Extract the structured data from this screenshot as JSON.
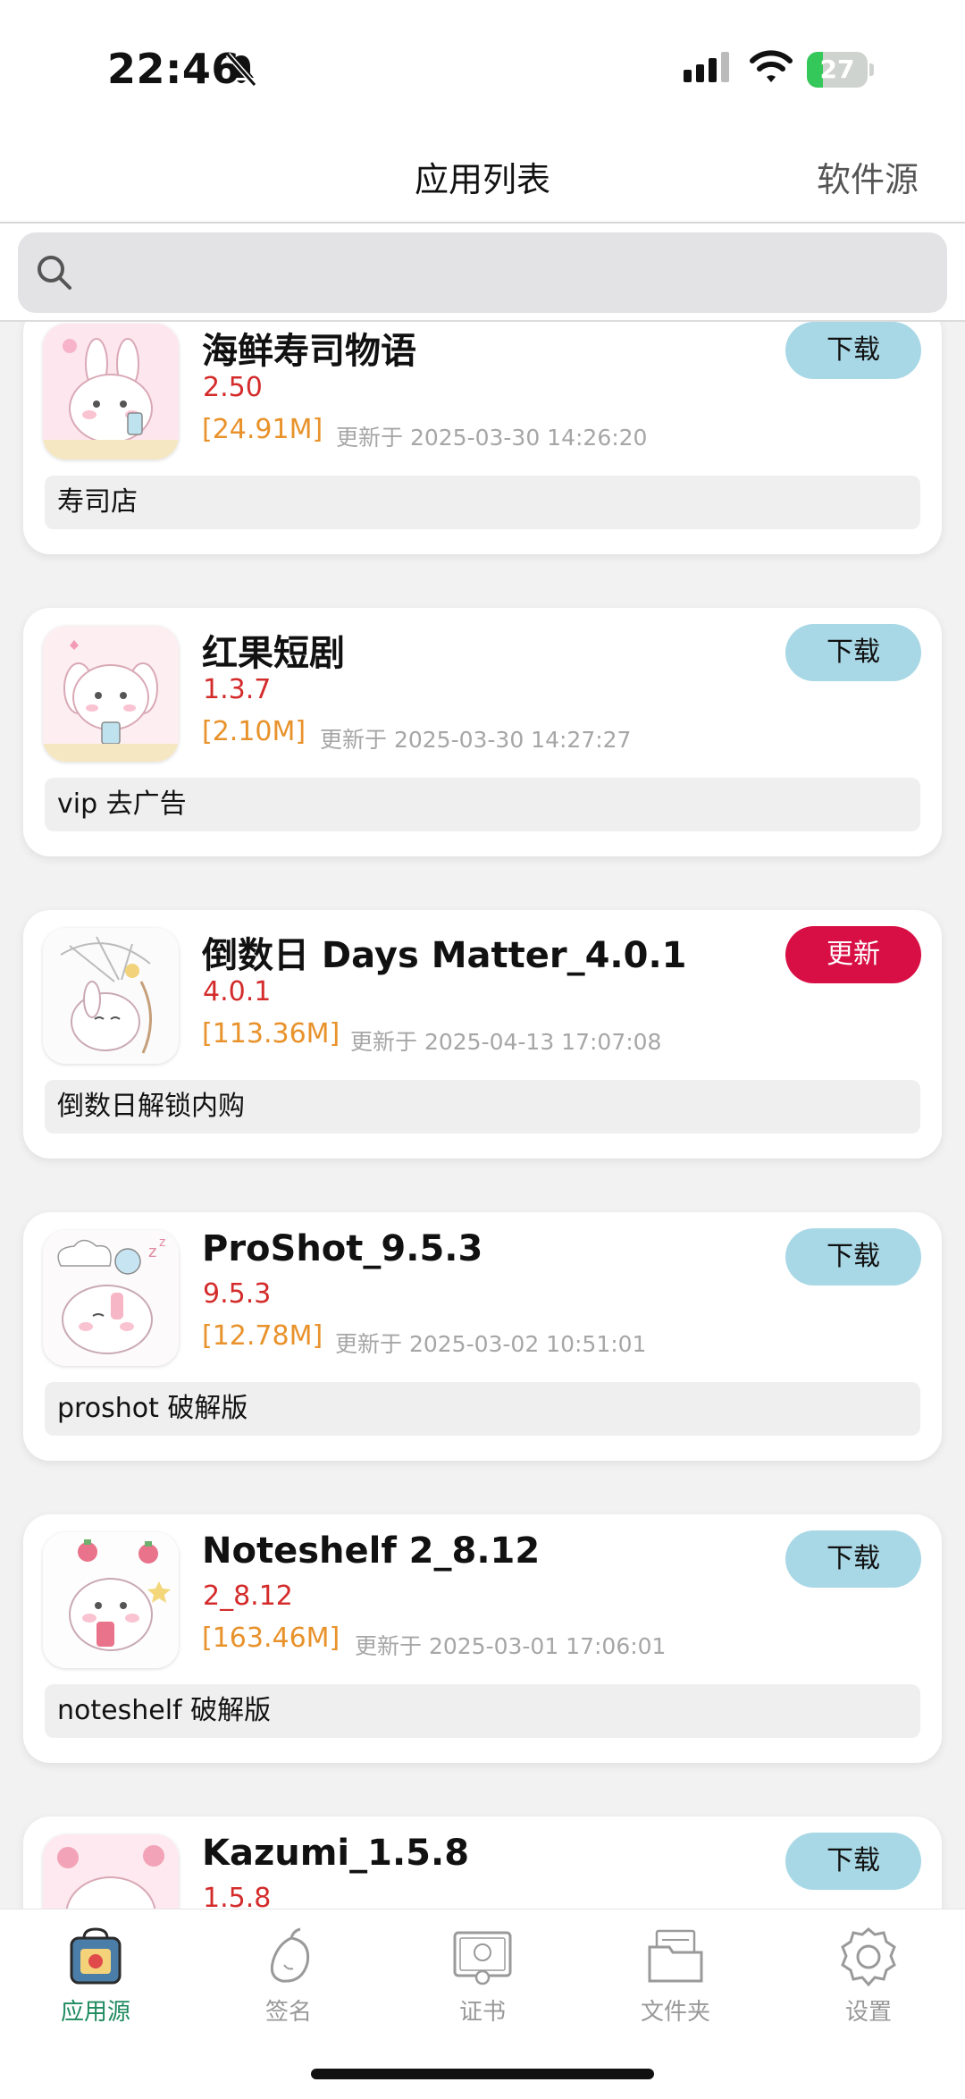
{
  "status_bar": {
    "time": "22:46",
    "battery": "27",
    "battery_level": 0.27
  },
  "nav": {
    "title": "应用列表",
    "right": "软件源"
  },
  "search": {
    "placeholder": ""
  },
  "apps": [
    {
      "name": "海鲜寿司物语",
      "version": "2.50",
      "size": "[24.91M]",
      "updated": "更新于 2025-03-30 14:26:20",
      "button": "下载",
      "description": "寿司店",
      "icon": "bunny-phone-icon"
    },
    {
      "name": "红果短剧",
      "version": "1.3.7",
      "size": "[2.10M]",
      "updated": "更新于 2025-03-30 14:27:27",
      "button": "下载",
      "description": "vip 去广告",
      "icon": "puppy-phone-icon"
    },
    {
      "name": "倒数日 Days Matter_4.0.1",
      "version": "4.0.1",
      "size": "[113.36M]",
      "updated": "更新于 2025-04-13 17:07:08",
      "button": "更新",
      "description": "倒数日解锁内购",
      "icon": "bunny-umbrella-icon"
    },
    {
      "name": "ProShot_9.5.3",
      "version": "9.5.3",
      "size": "[12.78M]",
      "updated": "更新于 2025-03-02 10:51:01",
      "button": "下载",
      "description": "proshot 破解版",
      "icon": "bunny-sleep-icon"
    },
    {
      "name": "Noteshelf 2_8.12",
      "version": "2_8.12",
      "size": "[163.46M]",
      "updated": "更新于 2025-03-01 17:06:01",
      "button": "下载",
      "description": "noteshelf 破解版",
      "icon": "bunny-strawberry-icon"
    },
    {
      "name": "Kazumi_1.5.8",
      "version": "1.5.8",
      "size": "",
      "updated": "",
      "button": "下载",
      "description": "",
      "icon": "bunny-flower-icon"
    }
  ],
  "tabs": [
    {
      "label": "应用源",
      "icon": "bag-icon",
      "active": true
    },
    {
      "label": "签名",
      "icon": "mango-icon",
      "active": false
    },
    {
      "label": "证书",
      "icon": "certificate-icon",
      "active": false
    },
    {
      "label": "文件夹",
      "icon": "folder-icon",
      "active": false
    },
    {
      "label": "设置",
      "icon": "gear-icon",
      "active": false
    }
  ],
  "colors": {
    "accent_green": "#1e8a5e",
    "download_button": "#a8d8e6",
    "update_button": "#d80f45",
    "version_red": "#d42b2b",
    "size_orange": "#e8922b"
  }
}
